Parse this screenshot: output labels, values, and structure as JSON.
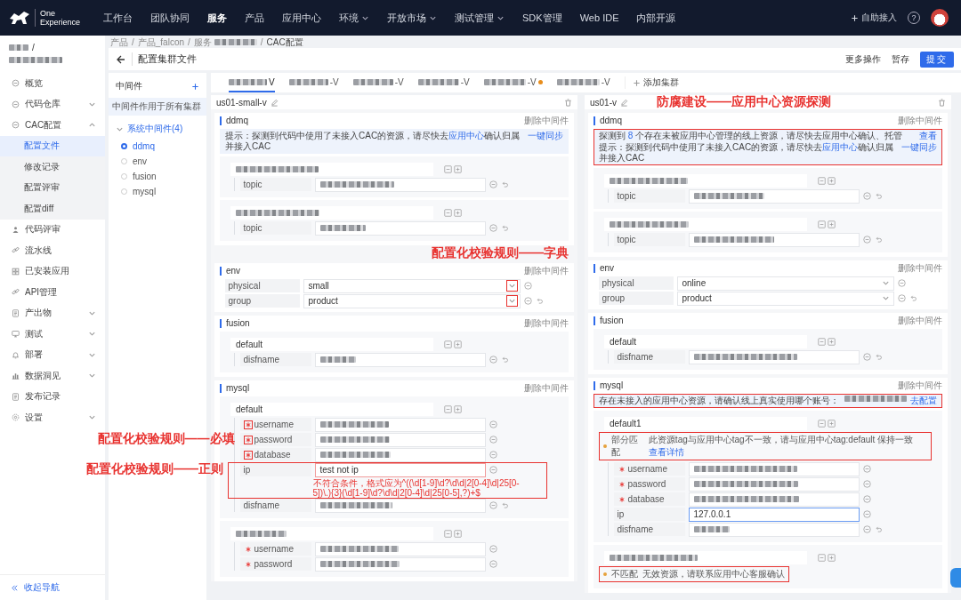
{
  "topbar": {
    "logo": [
      "One",
      "Experience"
    ],
    "nav": [
      {
        "label": "工作台",
        "selected": false,
        "dropdown": false
      },
      {
        "label": "团队协同",
        "selected": false,
        "dropdown": false
      },
      {
        "label": "服务",
        "selected": true,
        "dropdown": false
      },
      {
        "label": "产品",
        "selected": false,
        "dropdown": false
      },
      {
        "label": "应用中心",
        "selected": false,
        "dropdown": false
      },
      {
        "label": "环境",
        "selected": false,
        "dropdown": true
      },
      {
        "label": "开放市场",
        "selected": false,
        "dropdown": true
      },
      {
        "label": "测试管理",
        "selected": false,
        "dropdown": true
      },
      {
        "label": "SDK管理",
        "selected": false,
        "dropdown": false
      },
      {
        "label": "Web IDE",
        "selected": false,
        "dropdown": false
      },
      {
        "label": "内部开源",
        "selected": false,
        "dropdown": false
      }
    ],
    "self_service": "自助接入",
    "help": "?"
  },
  "sidebar": {
    "project_separator": "/",
    "items": [
      {
        "label": "概览",
        "selected": false
      },
      {
        "label": "代码仓库",
        "selected": false,
        "expanded": false
      },
      {
        "label": "CAC配置",
        "selected": false,
        "expanded": true,
        "children": [
          {
            "label": "配置文件",
            "selected": true
          },
          {
            "label": "修改记录",
            "selected": false
          },
          {
            "label": "配置评审",
            "selected": false
          },
          {
            "label": "配置diff",
            "selected": false
          }
        ]
      },
      {
        "label": "代码评审",
        "selected": false
      },
      {
        "label": "流水线",
        "selected": false
      },
      {
        "label": "已安装应用",
        "selected": false
      },
      {
        "label": "API管理",
        "selected": false
      },
      {
        "label": "产出物",
        "selected": false,
        "expanded": false
      },
      {
        "label": "测试",
        "selected": false,
        "expanded": false
      },
      {
        "label": "部署",
        "selected": false,
        "expanded": false
      },
      {
        "label": "数据洞见",
        "selected": false,
        "expanded": false
      },
      {
        "label": "发布记录",
        "selected": false
      },
      {
        "label": "设置",
        "selected": false,
        "expanded": false
      }
    ],
    "collapse": "收起导航"
  },
  "breadcrumb_separator": "/",
  "breadcrumb": [
    {
      "label": "产品",
      "redacted": false
    },
    {
      "label": "产品_falcon",
      "redacted": false
    },
    {
      "label": "服务",
      "redacted": true
    },
    {
      "label": "CAC配置",
      "redacted": false
    }
  ],
  "title": "配置集群文件",
  "actions": [
    {
      "label": "更多操作",
      "kind": "text"
    },
    {
      "label": "暂存",
      "kind": "text"
    },
    {
      "label": "提交",
      "kind": "primary"
    }
  ],
  "middleware": {
    "title": "中间件",
    "note": "中间件作用于所有集群",
    "group": {
      "label": "系统中间件(4)",
      "expanded": true,
      "items": [
        {
          "label": "ddmq",
          "selected": true
        },
        {
          "label": "env",
          "selected": false
        },
        {
          "label": "fusion",
          "selected": false
        },
        {
          "label": "mysql",
          "selected": false
        }
      ]
    }
  },
  "cluster_tabs": [
    {
      "suffix": "V",
      "selected": true,
      "warning": false
    },
    {
      "suffix": "-V",
      "selected": false,
      "warning": false
    },
    {
      "suffix": "-V",
      "selected": false,
      "warning": false
    },
    {
      "suffix": "-V",
      "selected": false,
      "warning": false
    },
    {
      "suffix": "-V",
      "selected": false,
      "warning": true
    },
    {
      "suffix": "-V",
      "selected": false,
      "warning": false
    }
  ],
  "add_cluster": "添加集群",
  "clusters": [
    {
      "name": "us01-small-v",
      "sections": [
        {
          "name": "ddmq",
          "delete": "删除中间件",
          "alerts_annotated": false,
          "alerts": [
            {
              "prefix": "提示：探测到代码中使用了未接入CAC的资源，请尽快去",
              "link": "应用中心",
              "suffix": "确认归属并接入CAC",
              "action": "一键同步"
            }
          ],
          "groups": [
            {
              "fields": [
                {
                  "label": "topic",
                  "kind": "input",
                  "undo": true
                }
              ]
            },
            {
              "fields": [
                {
                  "label": "topic",
                  "kind": "input",
                  "undo": true
                }
              ]
            }
          ]
        },
        {
          "name": "env",
          "delete": "删除中间件",
          "annotation": "配置化校验规则——字典",
          "fields": [
            {
              "label": "physical",
              "kind": "select",
              "value": "small",
              "highlighted": true,
              "undo": false
            },
            {
              "label": "group",
              "kind": "select",
              "value": "product",
              "highlighted": true,
              "undo": true
            }
          ]
        },
        {
          "name": "fusion",
          "delete": "删除中间件",
          "groups": [
            {
              "name": "default",
              "fields": [
                {
                  "label": "disfname",
                  "kind": "input",
                  "undo": true
                }
              ]
            }
          ]
        },
        {
          "name": "mysql",
          "delete": "删除中间件",
          "groups": [
            {
              "name": "default",
              "fields": [
                {
                  "label": "username",
                  "kind": "input",
                  "required": true,
                  "highlighted": true
                },
                {
                  "label": "password",
                  "kind": "input",
                  "required": true,
                  "highlighted": true,
                  "annotation": "配置化校验规则——必填"
                },
                {
                  "label": "database",
                  "kind": "input",
                  "required": true,
                  "highlighted": true
                },
                {
                  "label": "ip",
                  "kind": "input",
                  "value": "test not ip",
                  "error": "不符合条件，格式应为^((\\d[1-9]\\d?\\d\\d|2[0-4]\\d|25[0-5])\\.){3}(\\d[1-9]\\d?\\d\\d|2[0-4]\\d|25[0-5],?)+$",
                  "highlighted": true,
                  "annotation": "配置化校验规则——正则"
                },
                {
                  "label": "disfname",
                  "kind": "input",
                  "undo": true
                }
              ]
            },
            {
              "fields": [
                {
                  "label": "username",
                  "kind": "input",
                  "required": true
                },
                {
                  "label": "password",
                  "kind": "input",
                  "required": true
                }
              ]
            }
          ]
        }
      ]
    },
    {
      "name": "us01-v",
      "annotation": "防腐建设——应用中心资源探测",
      "sections": [
        {
          "name": "ddmq",
          "delete": "删除中间件",
          "alerts_annotated": true,
          "alerts": [
            {
              "prefix": "探测到 ",
              "em": "8",
              "suffix": " 个存在未被应用中心管理的线上资源，请尽快去应用中心确认、托管",
              "action": "查看"
            },
            {
              "prefix": "提示：探测到代码中使用了未接入CAC的资源，请尽快去",
              "link": "应用中心",
              "suffix": "确认归属并接入CAC",
              "action": "一键同步"
            }
          ],
          "groups": [
            {
              "fields": [
                {
                  "label": "topic",
                  "kind": "input",
                  "undo": true
                }
              ]
            },
            {
              "fields": [
                {
                  "label": "topic",
                  "kind": "input",
                  "undo": true
                }
              ]
            }
          ]
        },
        {
          "name": "env",
          "delete": "删除中间件",
          "fields": [
            {
              "label": "physical",
              "kind": "select",
              "value": "online",
              "undo": false
            },
            {
              "label": "group",
              "kind": "select",
              "value": "product",
              "undo": true
            }
          ]
        },
        {
          "name": "fusion",
          "delete": "删除中间件",
          "groups": [
            {
              "name": "default",
              "fields": [
                {
                  "label": "disfname",
                  "kind": "input",
                  "undo": true
                }
              ]
            }
          ]
        },
        {
          "name": "mysql",
          "delete": "删除中间件",
          "alerts_annotated": true,
          "alerts": [
            {
              "prefix": "存在未接入的应用中心资源，请确认线上真实使用哪个账号：",
              "redacted": true,
              "action": "去配置"
            }
          ],
          "groups": [
            {
              "name": "default1",
              "notice": {
                "status": "部分匹配",
                "color": "#e6a23c",
                "text": "此资源tag与应用中心tag不一致，请与应用中心tag:default 保持一致",
                "link": "查看详情",
                "annotated": true
              },
              "fields": [
                {
                  "label": "username",
                  "kind": "input",
                  "required": true
                },
                {
                  "label": "password",
                  "kind": "input",
                  "required": true
                },
                {
                  "label": "database",
                  "kind": "input",
                  "required": true
                },
                {
                  "label": "ip",
                  "kind": "input",
                  "value": "127.0.0.1",
                  "focused": true
                },
                {
                  "label": "disfname",
                  "kind": "input",
                  "undo": true
                }
              ]
            },
            {
              "notice": {
                "status": "不匹配",
                "color": "#e6a23c",
                "text": "无效资源，请联系应用中心客服确认",
                "annotated": true
              }
            }
          ]
        }
      ]
    }
  ]
}
